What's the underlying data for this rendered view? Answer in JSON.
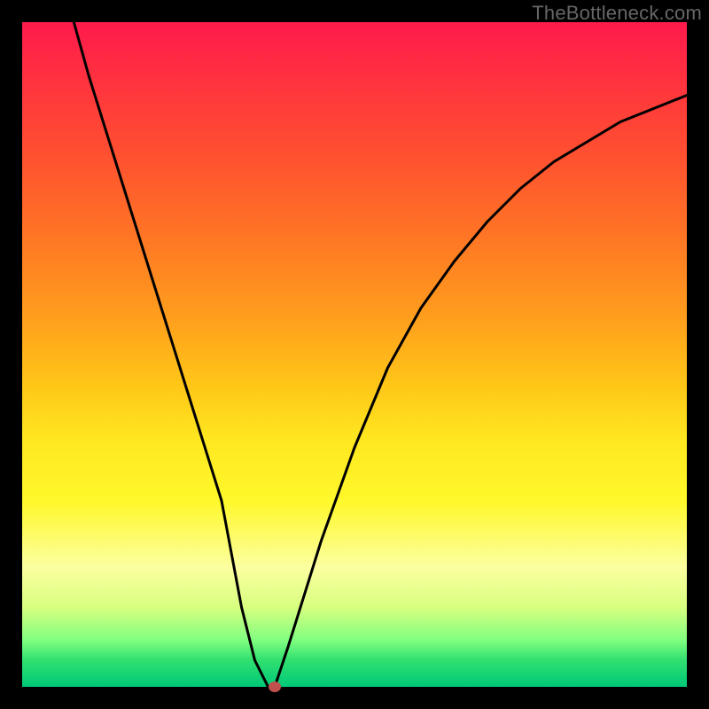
{
  "watermark": "TheBottleneck.com",
  "chart_data": {
    "type": "line",
    "title": "",
    "xlabel": "",
    "ylabel": "",
    "xlim": [
      0,
      100
    ],
    "ylim": [
      0,
      100
    ],
    "grid": false,
    "series": [
      {
        "name": "bottleneck-curve",
        "x": [
          0,
          5,
          10,
          15,
          20,
          25,
          30,
          33,
          35,
          37,
          38,
          40,
          45,
          50,
          55,
          60,
          65,
          70,
          75,
          80,
          85,
          90,
          95,
          100
        ],
        "values": [
          130,
          110,
          92,
          76,
          60,
          44,
          28,
          12,
          4,
          0,
          0,
          6,
          22,
          36,
          48,
          57,
          64,
          70,
          75,
          79,
          82,
          85,
          87,
          89
        ]
      }
    ],
    "marker": {
      "x": 38,
      "y": 0,
      "color": "#c0504d"
    },
    "background_gradient": {
      "top": "#ff1a4d",
      "upper_mid": "#ff7525",
      "mid": "#ffe820",
      "lower_mid": "#fcffa0",
      "bottom": "#00c878"
    }
  }
}
